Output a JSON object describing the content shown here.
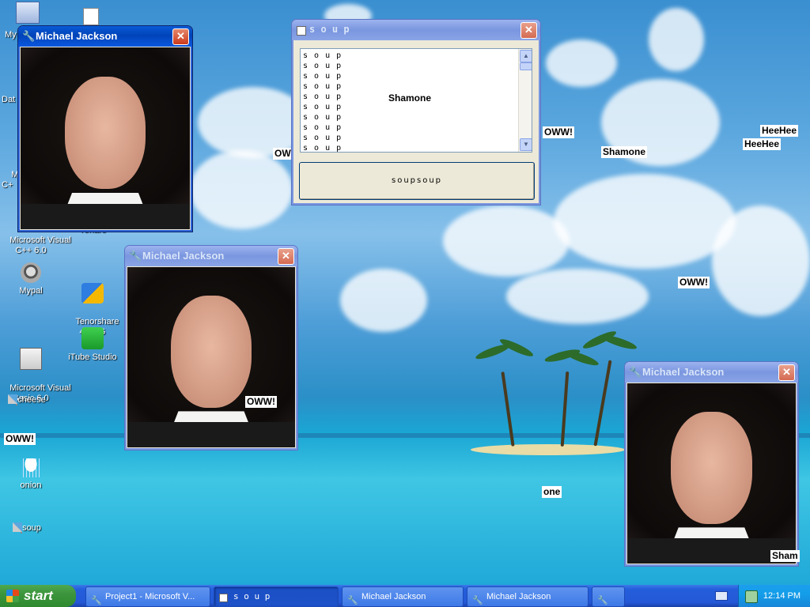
{
  "desktop": {
    "icons": [
      {
        "label": "My",
        "kind": "computer-icon"
      },
      {
        "label": "Dat",
        "kind": "document-icon"
      },
      {
        "label": "Micro\nC+",
        "kind": "app-icon"
      },
      {
        "label": "Microsoft Visual\nC++ 6.0",
        "kind": "app-icon"
      },
      {
        "label": "Yonaro",
        "kind": "app-icon"
      },
      {
        "label": "Mypal",
        "kind": "raccoon-icon"
      },
      {
        "label": "Tenorshare\n4DDiG",
        "kind": "tenorshare-icon"
      },
      {
        "label": "Microsoft Visual\nBasic 6.0",
        "kind": "vb-icon"
      },
      {
        "label": "iTube Studio",
        "kind": "download-icon"
      },
      {
        "label": "cheese",
        "kind": "document-icon"
      },
      {
        "label": "onion",
        "kind": "rain-cloud-icon"
      },
      {
        "label": "soup",
        "kind": "document-icon"
      }
    ],
    "floating_labels": [
      {
        "id": "oww1",
        "text": "OWW!"
      },
      {
        "id": "oww2",
        "text": "OWW!"
      },
      {
        "id": "oww3",
        "text": "OWW!"
      },
      {
        "id": "oww4",
        "text": "OWW!"
      },
      {
        "id": "oww5",
        "text": "OWW!"
      },
      {
        "id": "heehee1",
        "text": "HeeHee"
      },
      {
        "id": "heehee2",
        "text": "HeeHee"
      },
      {
        "id": "shamone1",
        "text": "Shamone"
      },
      {
        "id": "one1",
        "text": "one"
      },
      {
        "id": "sham1",
        "text": "Sham"
      }
    ]
  },
  "windows": {
    "mj1": {
      "title": "Michael Jackson",
      "close": "✕"
    },
    "mj2": {
      "title": "Michael Jackson",
      "close": "✕"
    },
    "mj3": {
      "title": "Michael Jackson",
      "close": "✕"
    },
    "soup": {
      "title": "s o u p",
      "close": "✕",
      "list_items": [
        "s o u p",
        "s o u p",
        "s o u p",
        "s o u p",
        "s o u p",
        "s o u p",
        "s o u p",
        "s o u p",
        "s o u p",
        "s o u p"
      ],
      "list_label": "Shamone",
      "button_label": "soupsoup"
    }
  },
  "taskbar": {
    "start_label": "start",
    "tasks": [
      {
        "label": "Project1 - Microsoft V...",
        "active": false
      },
      {
        "label": "s o u p",
        "active": true
      },
      {
        "label": "Michael Jackson",
        "active": false
      },
      {
        "label": "Michael Jackson",
        "active": false
      },
      {
        "label": "",
        "active": false
      }
    ],
    "clock": "12:14 PM"
  },
  "colors": {
    "title_active": "#0a5bd8",
    "title_inactive": "#7a96df",
    "taskbar": "#245edb",
    "start": "#3c953c"
  }
}
